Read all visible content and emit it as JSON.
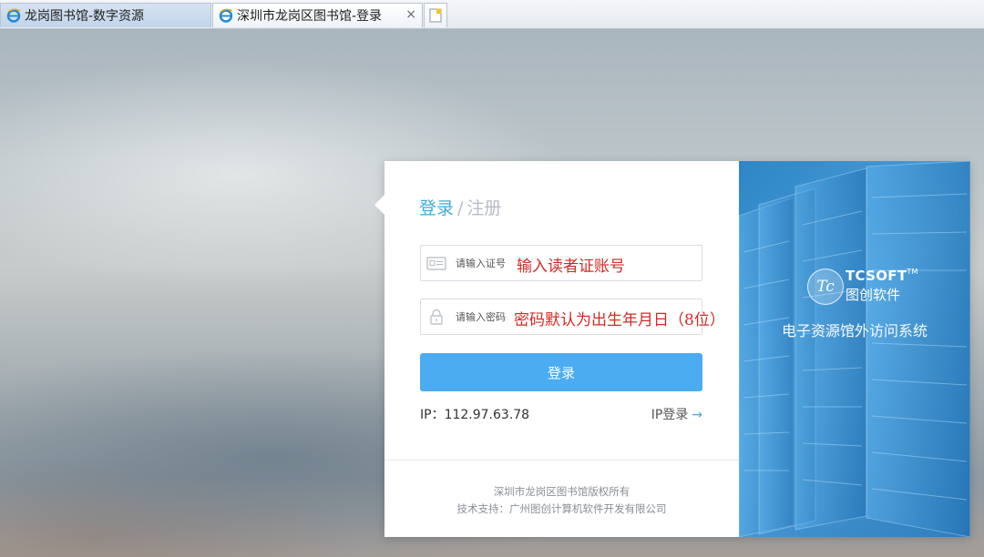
{
  "tabs": [
    {
      "label": "龙岗图书馆-数字资源",
      "active": false
    },
    {
      "label": "深圳市龙岗区图书馆-登录",
      "active": true,
      "close": "×"
    }
  ],
  "login": {
    "heading_login": "登录",
    "heading_sep": "/",
    "heading_register": "注册",
    "username_placeholder": "请输入证号",
    "username_annotation": "输入读者证账号",
    "password_placeholder": "请输入密码",
    "password_annotation": "密码默认为出生年月日（8位）",
    "submit_label": "登录",
    "ip_text": "IP：112.97.63.78",
    "ip_login_label": "IP登录",
    "ip_login_arrow": "→",
    "footer_line1": "深圳市龙岗区图书馆版权所有",
    "footer_line2": "技术支持：广州图创计算机软件开发有限公司"
  },
  "brand": {
    "logo_text": "Tc",
    "name_en": "TCSOFT",
    "tm": "TM",
    "name_cn": "图创软件",
    "system_name": "电子资源馆外访问系统"
  },
  "colors": {
    "accent": "#4bacf2",
    "heading_active": "#43a8dc",
    "annotation_red": "#d42a26",
    "panel_blue": "#2e86c6"
  }
}
